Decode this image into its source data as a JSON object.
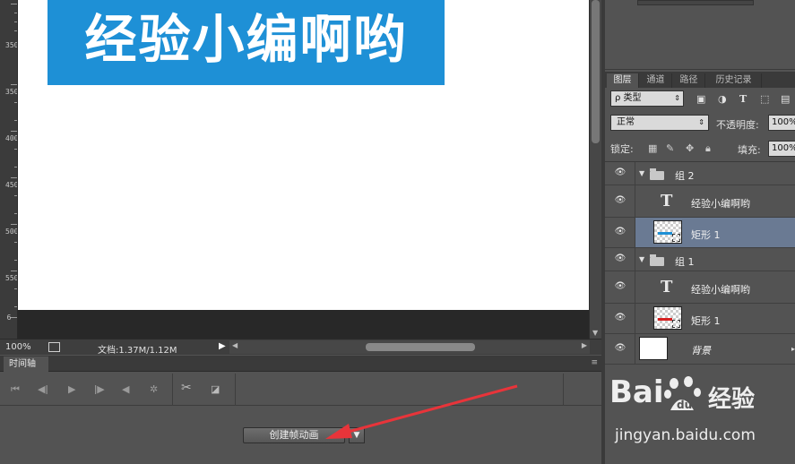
{
  "canvas": {
    "banner_text": "经验小编啊哟",
    "banner_color": "#1e90d6"
  },
  "ruler": {
    "labels": [
      "350",
      "400",
      "450",
      "500",
      "550",
      "6"
    ]
  },
  "status": {
    "zoom": "100%",
    "doc_info": "文档:1.37M/1.12M"
  },
  "timeline": {
    "tab_label": "时间轴",
    "create_button": "创建帧动画",
    "dropdown_glyph": "▼"
  },
  "panel": {
    "tabs": [
      "图层",
      "通道",
      "路径",
      "历史记录"
    ],
    "filter_label": "ρ 类型",
    "blend_mode": "正常",
    "opacity_label": "不透明度:",
    "opacity_value": "100%",
    "lock_label": "锁定:",
    "fill_label": "填充:",
    "fill_value": "100%"
  },
  "layers": [
    {
      "name": "组 2",
      "kind": "group"
    },
    {
      "name": "经验小编啊哟",
      "kind": "text"
    },
    {
      "name": "矩形 1",
      "kind": "shape",
      "selected": true,
      "bar_color": "#1e90d6"
    },
    {
      "name": "组 1",
      "kind": "group"
    },
    {
      "name": "经验小编啊哟",
      "kind": "text"
    },
    {
      "name": "矩形 1",
      "kind": "shape",
      "bar_color": "#d62020"
    },
    {
      "name": "背景",
      "kind": "background"
    }
  ],
  "watermark": {
    "logo": "Bai",
    "logo_suffix": "经验",
    "url": "jingyan.baidu.com"
  },
  "colors": {
    "annotation_arrow": "#e8343a",
    "selected_layer": "#6a7a93"
  }
}
